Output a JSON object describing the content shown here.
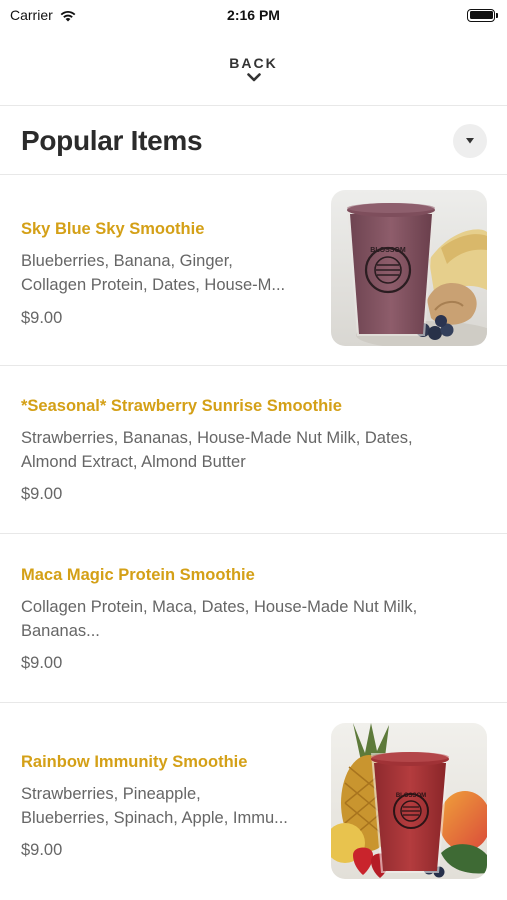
{
  "status_bar": {
    "carrier": "Carrier",
    "time": "2:16 PM"
  },
  "nav": {
    "back_label": "BACK"
  },
  "section": {
    "title": "Popular Items"
  },
  "items": [
    {
      "name": "Sky Blue Sky Smoothie",
      "description_lines": [
        "Blueberries, Banana, Ginger,",
        "Collagen Protein, Dates, House-M..."
      ],
      "price": "$9.00",
      "has_photo": true,
      "photo_cup_label": "BLOSSOM"
    },
    {
      "name": "*Seasonal* Strawberry Sunrise Smoothie",
      "description_lines": [
        "Strawberries, Bananas, House-Made Nut Milk, Dates,",
        "Almond Extract, Almond Butter"
      ],
      "price": "$9.00",
      "has_photo": false
    },
    {
      "name": "Maca Magic Protein Smoothie",
      "description_lines": [
        "Collagen Protein, Maca, Dates, House-Made Nut Milk,",
        "Bananas..."
      ],
      "price": "$9.00",
      "has_photo": false
    },
    {
      "name": "Rainbow Immunity Smoothie",
      "description_lines": [
        "Strawberries, Pineapple,",
        "Blueberries, Spinach, Apple, Immu..."
      ],
      "price": "$9.00",
      "has_photo": true,
      "photo_cup_label": "BLOSSOM"
    }
  ],
  "colors": {
    "item_name": "#d4a017",
    "text_secondary": "#666666",
    "divider": "#e8e8e8"
  }
}
